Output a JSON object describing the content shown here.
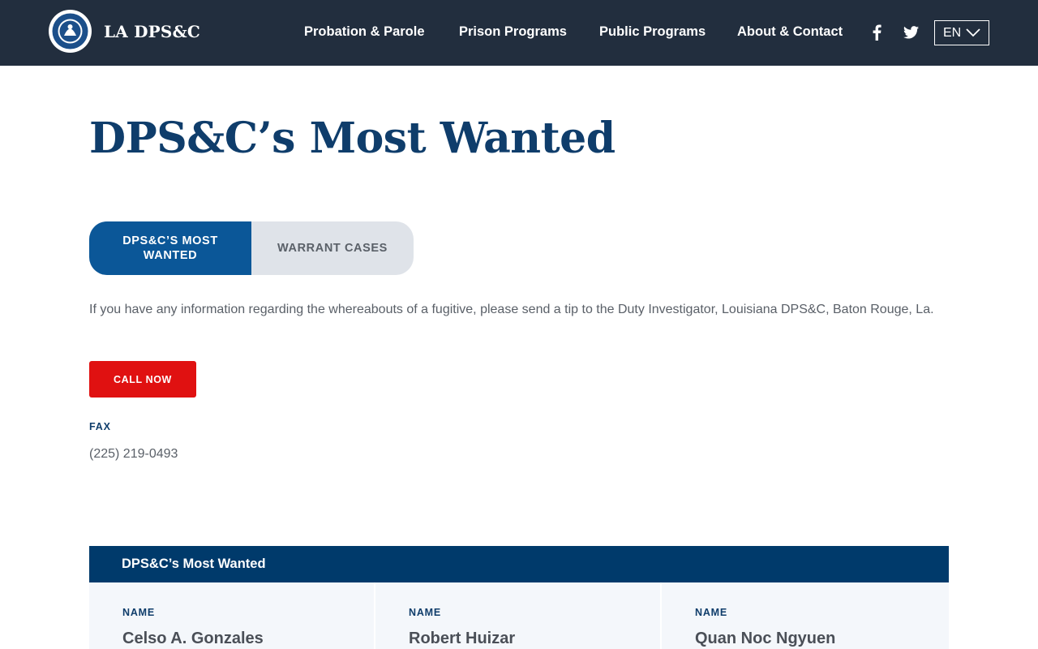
{
  "header": {
    "brand_name": "LA DPS&C",
    "nav": [
      "Probation & Parole",
      "Prison Programs",
      "Public Programs",
      "About & Contact"
    ],
    "social_icons": [
      "facebook-icon",
      "twitter-icon"
    ],
    "language": "EN"
  },
  "main": {
    "title": "DPS&C’s Most Wanted",
    "tabs": [
      {
        "label": "DPS&C’S MOST WANTED",
        "active": true
      },
      {
        "label": "WARRANT CASES",
        "active": false
      }
    ],
    "intro": "If you have any information regarding the whereabouts of a fugitive, please send a tip to the Duty Investigator, Louisiana DPS&C, Baton Rouge, La.",
    "call_button": "CALL NOW",
    "fax_label": "FAX",
    "fax_number": "(225) 219-0493"
  },
  "wanted": {
    "heading": "DPS&C’s Most Wanted",
    "cards": [
      {
        "label": "NAME",
        "name": "Celso A. Gonzales"
      },
      {
        "label": "NAME",
        "name": "Robert Huizar"
      },
      {
        "label": "NAME",
        "name": "Quan Noc Ngyuen"
      }
    ]
  },
  "colors": {
    "header_bg": "#222e3e",
    "title": "#0f3d6b",
    "tab_active": "#0b5798",
    "tab_inactive": "#dfe3e9",
    "call_button": "#e01111",
    "section_header": "#003a6b"
  }
}
